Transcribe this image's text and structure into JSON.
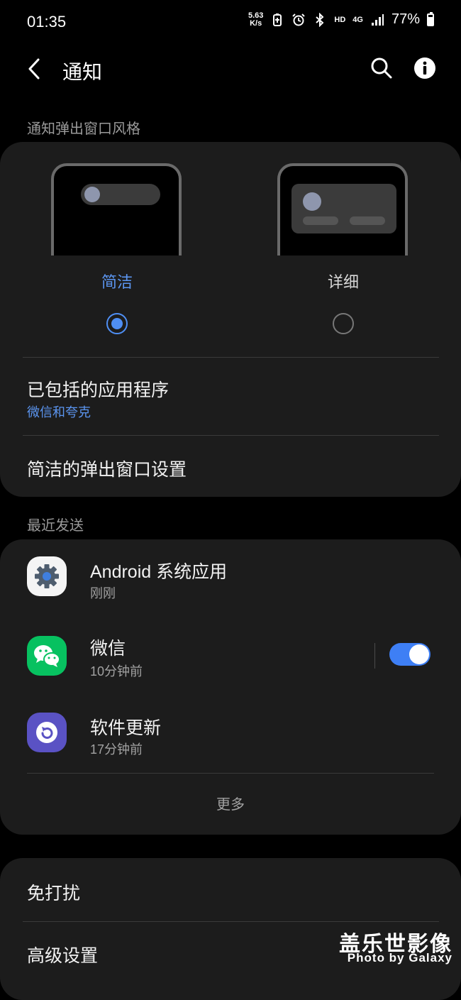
{
  "status_bar": {
    "time": "01:35",
    "net_speed_value": "5.63",
    "net_speed_unit": "K/s",
    "hd": "HD",
    "network": "4G",
    "battery": "77%",
    "battery_level": 0.77
  },
  "header": {
    "title": "通知",
    "back_icon": "chevron-left-icon",
    "search_icon": "search-icon",
    "info_icon": "info-icon"
  },
  "popup_style": {
    "section_label": "通知弹出窗口风格",
    "options": [
      {
        "label": "简洁",
        "selected": true
      },
      {
        "label": "详细",
        "selected": false
      }
    ],
    "included_apps_title": "已包括的应用程序",
    "included_apps_value": "微信和夸克",
    "brief_settings_title": "简洁的弹出窗口设置"
  },
  "recent": {
    "section_label": "最近发送",
    "apps": [
      {
        "name": "Android 系统应用",
        "time": "刚刚",
        "icon": "gear-icon"
      },
      {
        "name": "微信",
        "time": "10分钟前",
        "icon": "wechat-icon",
        "toggle_on": true
      },
      {
        "name": "软件更新",
        "time": "17分钟前",
        "icon": "software-update-icon"
      }
    ],
    "more_label": "更多"
  },
  "other": {
    "dnd_title": "免打扰",
    "advanced_title": "高级设置"
  },
  "watermark": {
    "cn": "盖乐世影像",
    "en": "Photo by Galaxy"
  },
  "colors": {
    "accent": "#4f8ff4",
    "card": "#1c1c1c",
    "background": "#000000"
  }
}
